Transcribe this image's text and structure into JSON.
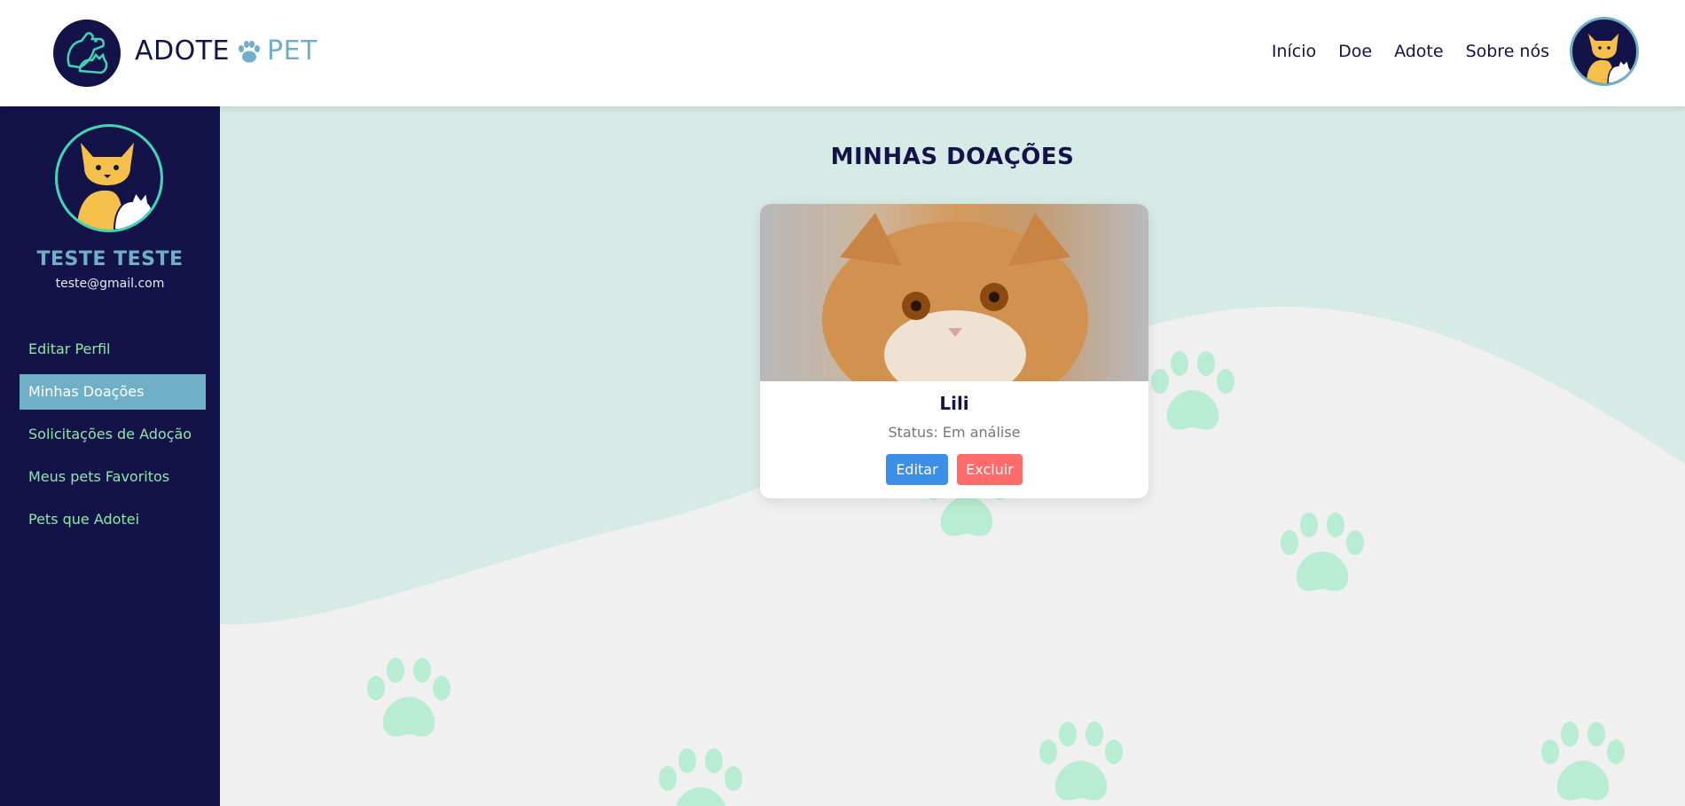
{
  "header": {
    "brand_left": "ADOTE",
    "brand_right": "PET",
    "nav": [
      "Início",
      "Doe",
      "Adote",
      "Sobre nós"
    ]
  },
  "sidebar": {
    "user_name": "TESTE TESTE",
    "user_email": "teste@gmail.com",
    "items": [
      {
        "label": "Editar Perfil",
        "active": false
      },
      {
        "label": "Minhas Doações",
        "active": true
      },
      {
        "label": "Solicitações de Adoção",
        "active": false
      },
      {
        "label": "Meus pets Favoritos",
        "active": false
      },
      {
        "label": "Pets que Adotei",
        "active": false
      }
    ]
  },
  "main": {
    "title": "MINHAS DOAÇÕES",
    "card": {
      "name": "Lili",
      "status": "Status: Em análise",
      "edit_label": "Editar",
      "delete_label": "Excluir"
    }
  },
  "colors": {
    "navy": "#13134a",
    "teal": "#6fb0c7",
    "mint": "#8ee6a6",
    "wave": "#d6eae6",
    "paw": "#b8ecd3",
    "edit": "#3d8ee6",
    "delete": "#ff6b6b"
  },
  "icons": [
    "dog-cat-logo-icon",
    "paw-icon",
    "user-avatar-icon",
    "paw-decoration-icon"
  ]
}
